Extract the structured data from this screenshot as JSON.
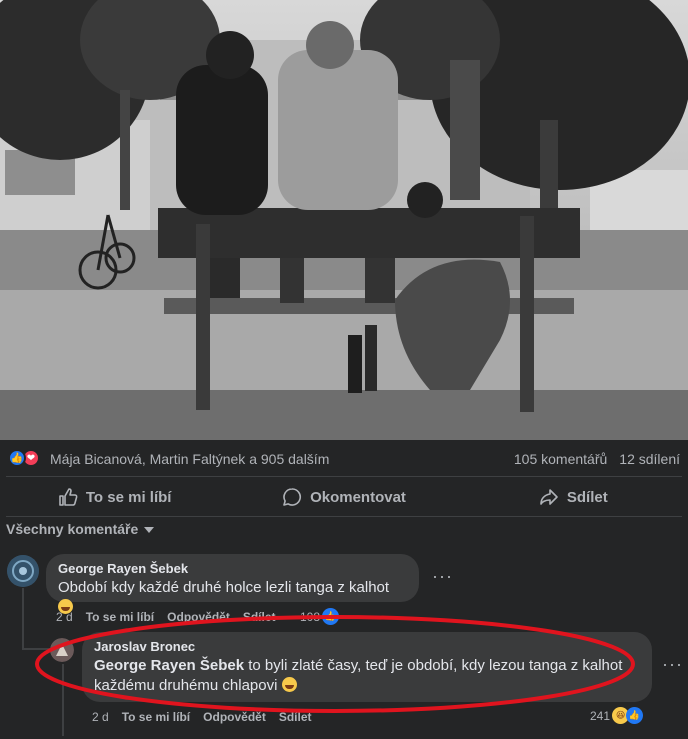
{
  "post": {
    "reactions_names": "Mája Bicanová, Martin Faltýnek a 905 dalším",
    "comments_count": "105 komentářů",
    "shares_count": "12 sdílení"
  },
  "actions": {
    "like": "To se mi líbí",
    "comment": "Okomentovat",
    "share": "Sdílet"
  },
  "comments_filter": "Všechny komentáře",
  "comments": [
    {
      "author": "George Rayen Šebek",
      "text": "Období kdy každé druhé holce lezli tanga z kalhot",
      "time": "2 d",
      "like": "To se mi líbí",
      "reply": "Odpovědět",
      "share": "Sdílet",
      "reaction_count": "108"
    },
    {
      "author": "Jaroslav Bronec",
      "mention": "George Rayen Šebek",
      "text": "to byli zlaté časy, teď je období, kdy lezou tanga z kalhot každému druhému chlapovi",
      "time": "2 d",
      "like": "To se mi líbí",
      "reply": "Odpovědět",
      "share": "Sdílet",
      "reaction_count": "241"
    }
  ],
  "colors": {
    "background": "#242526",
    "bubble": "#3a3b3c",
    "like_blue": "#2078f4",
    "love_red": "#f33e58",
    "annotation_red": "#e0141e"
  },
  "icons": [
    "like-icon",
    "love-icon",
    "thumbs-up-icon",
    "comment-icon",
    "share-icon",
    "caret-down-icon",
    "more-icon",
    "laugh-emoji-icon"
  ]
}
